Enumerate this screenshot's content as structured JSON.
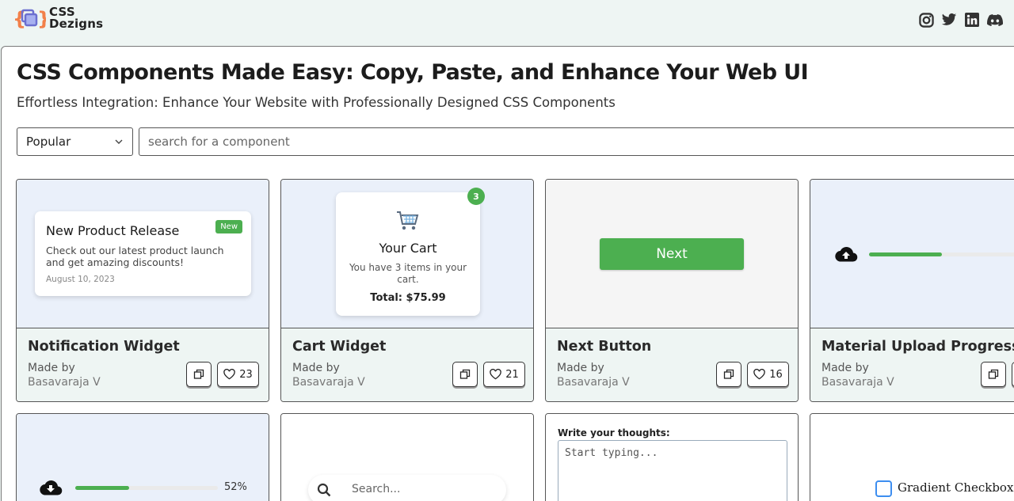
{
  "brand": {
    "line1": "CSS",
    "line2": "Dezigns"
  },
  "socials": [
    "instagram-icon",
    "twitter-icon",
    "linkedin-icon",
    "discord-icon"
  ],
  "hero": {
    "title": "CSS Components Made Easy: Copy, Paste, and Enhance Your Web UI",
    "subtitle": "Effortless Integration: Enhance Your Website with Professionally Designed CSS Components"
  },
  "filter": {
    "selected": "Popular"
  },
  "search": {
    "placeholder": "search for a component"
  },
  "cards": [
    {
      "title": "Notification Widget",
      "made_by": "Made by",
      "author": "Basavaraja V",
      "likes": "23",
      "preview": {
        "title": "New Product Release",
        "badge": "New",
        "message": "Check out our latest product launch and get amazing discounts!",
        "date": "August 10, 2023"
      }
    },
    {
      "title": "Cart Widget",
      "made_by": "Made by",
      "author": "Basavaraja V",
      "likes": "21",
      "preview": {
        "count": "3",
        "title": "Your Cart",
        "message": "You have 3 items in your cart.",
        "total": "Total: $75.99"
      }
    },
    {
      "title": "Next Button",
      "made_by": "Made by",
      "author": "Basavaraja V",
      "likes": "16",
      "preview": {
        "button": "Next"
      }
    },
    {
      "title": "Material Upload Progress",
      "made_by": "Made by",
      "author": "Basavaraja V",
      "preview": {
        "progress": 0.4
      }
    },
    {
      "preview": {
        "progress": 0.38,
        "percent": "52%"
      }
    },
    {
      "preview": {
        "placeholder": "Search..."
      }
    },
    {
      "preview": {
        "label": "Write your thoughts:",
        "placeholder": "Start typing..."
      }
    },
    {
      "preview": {
        "label": "Gradient Checkbox"
      }
    }
  ],
  "colors": {
    "accent": "#4caf50",
    "page_bg": "#eef5f3",
    "checkbox_border": "#3d8ef0"
  }
}
